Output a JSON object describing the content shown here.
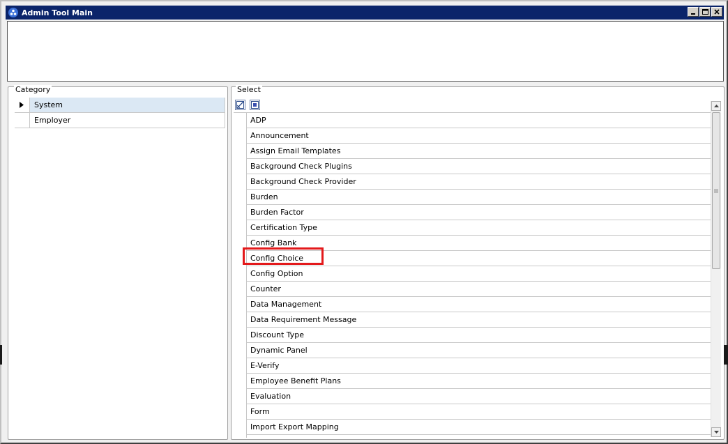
{
  "window": {
    "title": "Admin Tool Main",
    "icons": {
      "app": "app-logo-icon",
      "minimize": "minimize-icon",
      "maximize": "maximize-icon",
      "close": "close-icon"
    }
  },
  "category": {
    "label": "Category",
    "items": [
      {
        "label": "System",
        "selected": true
      },
      {
        "label": "Employer",
        "selected": false
      }
    ]
  },
  "select": {
    "label": "Select",
    "header_icons": [
      "select-all-icon",
      "deselect-icon"
    ],
    "items": [
      "ADP",
      "Announcement",
      "Assign Email Templates",
      "Background Check Plugins",
      "Background Check Provider",
      "Burden",
      "Burden Factor",
      "Certification Type",
      "Config Bank",
      "Config Choice",
      "Config Option",
      "Counter",
      "Data Management",
      "Data Requirement Message",
      "Discount Type",
      "Dynamic Panel",
      "E-Verify",
      "Employee Benefit Plans",
      "Evaluation",
      "Form",
      "Import Export Mapping"
    ],
    "highlighted_item": "Config Choice"
  },
  "colors": {
    "titlebar": "#0a246a",
    "selected_row": "#dbe8f4",
    "highlight": "#e3191b"
  }
}
